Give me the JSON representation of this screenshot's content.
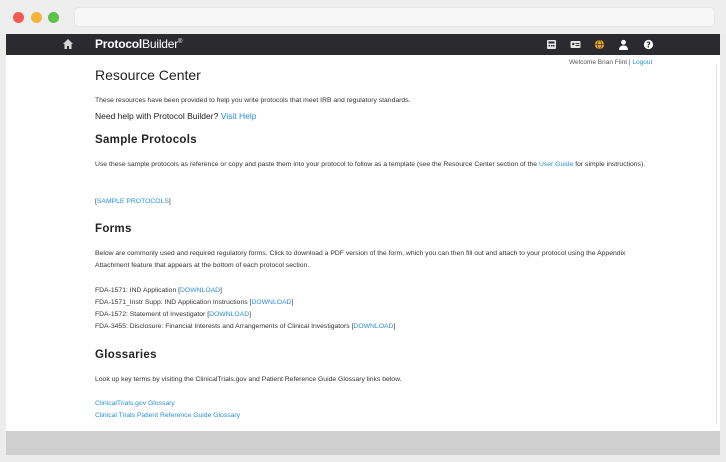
{
  "header": {
    "brand_bold": "Protocol",
    "brand_light": "Builder",
    "brand_mark": "®",
    "home_icon": "home-icon",
    "right_icons": [
      "calculator-icon",
      "id-card-icon",
      "globe-icon",
      "user-icon",
      "help-icon"
    ]
  },
  "user_bar": {
    "welcome": "Welcome",
    "name": "Brian Flint",
    "separator": "|",
    "logout": "Logout"
  },
  "page": {
    "title": "Resource Center",
    "intro": "These resources have been provided to help you write protocols that meet IRB and regulatory standards.",
    "help_prefix": "Need help with Protocol Builder?",
    "help_link": "Visit Help"
  },
  "sample_protocols": {
    "title": "Sample Protocols",
    "text_before": "Use these sample protocols as reference or copy and paste them into your protocol to follow as a template (see the Resource Center section of the",
    "user_guide_link": "User Guide",
    "text_after": "for simple instructions).",
    "link_open": "[",
    "link_label": "SAMPLE PROTOCOLS",
    "link_close": "]"
  },
  "forms": {
    "title": "Forms",
    "text": "Below are commonly used and required regulatory forms. Click to download a PDF version of the form, which you can then fill out and attach to your protocol using the Appendix Attachment feature that appears at the bottom of each protocol section.",
    "items": [
      {
        "label": "FDA-1571: IND Application",
        "link": "DOWNLOAD"
      },
      {
        "label": "FDA-1571_Instr Supp: IND Application Instructions",
        "link": "DOWNLOAD"
      },
      {
        "label": "FDA-1572: Statement of Investigator",
        "link": "DOWNLOAD"
      },
      {
        "label": "FDA-3455: Disclosure: Financial Interests and Arrangements of Clinical Investigators",
        "link": "DOWNLOAD"
      }
    ],
    "bracket_open": "[",
    "bracket_close": "]"
  },
  "glossaries": {
    "title": "Glossaries",
    "text": "Look up key terms by visiting the ClinicalTrials.gov and Patient Reference Guide Glossary links below.",
    "links": [
      "ClinicalTrials.gov Glossary",
      "Clinical Trials Patient Reference Guide Glossary"
    ]
  },
  "colors": {
    "nav_bg": "#2b2b2f",
    "link": "#2b8fd6",
    "globe_accent": "#e8a21a"
  }
}
